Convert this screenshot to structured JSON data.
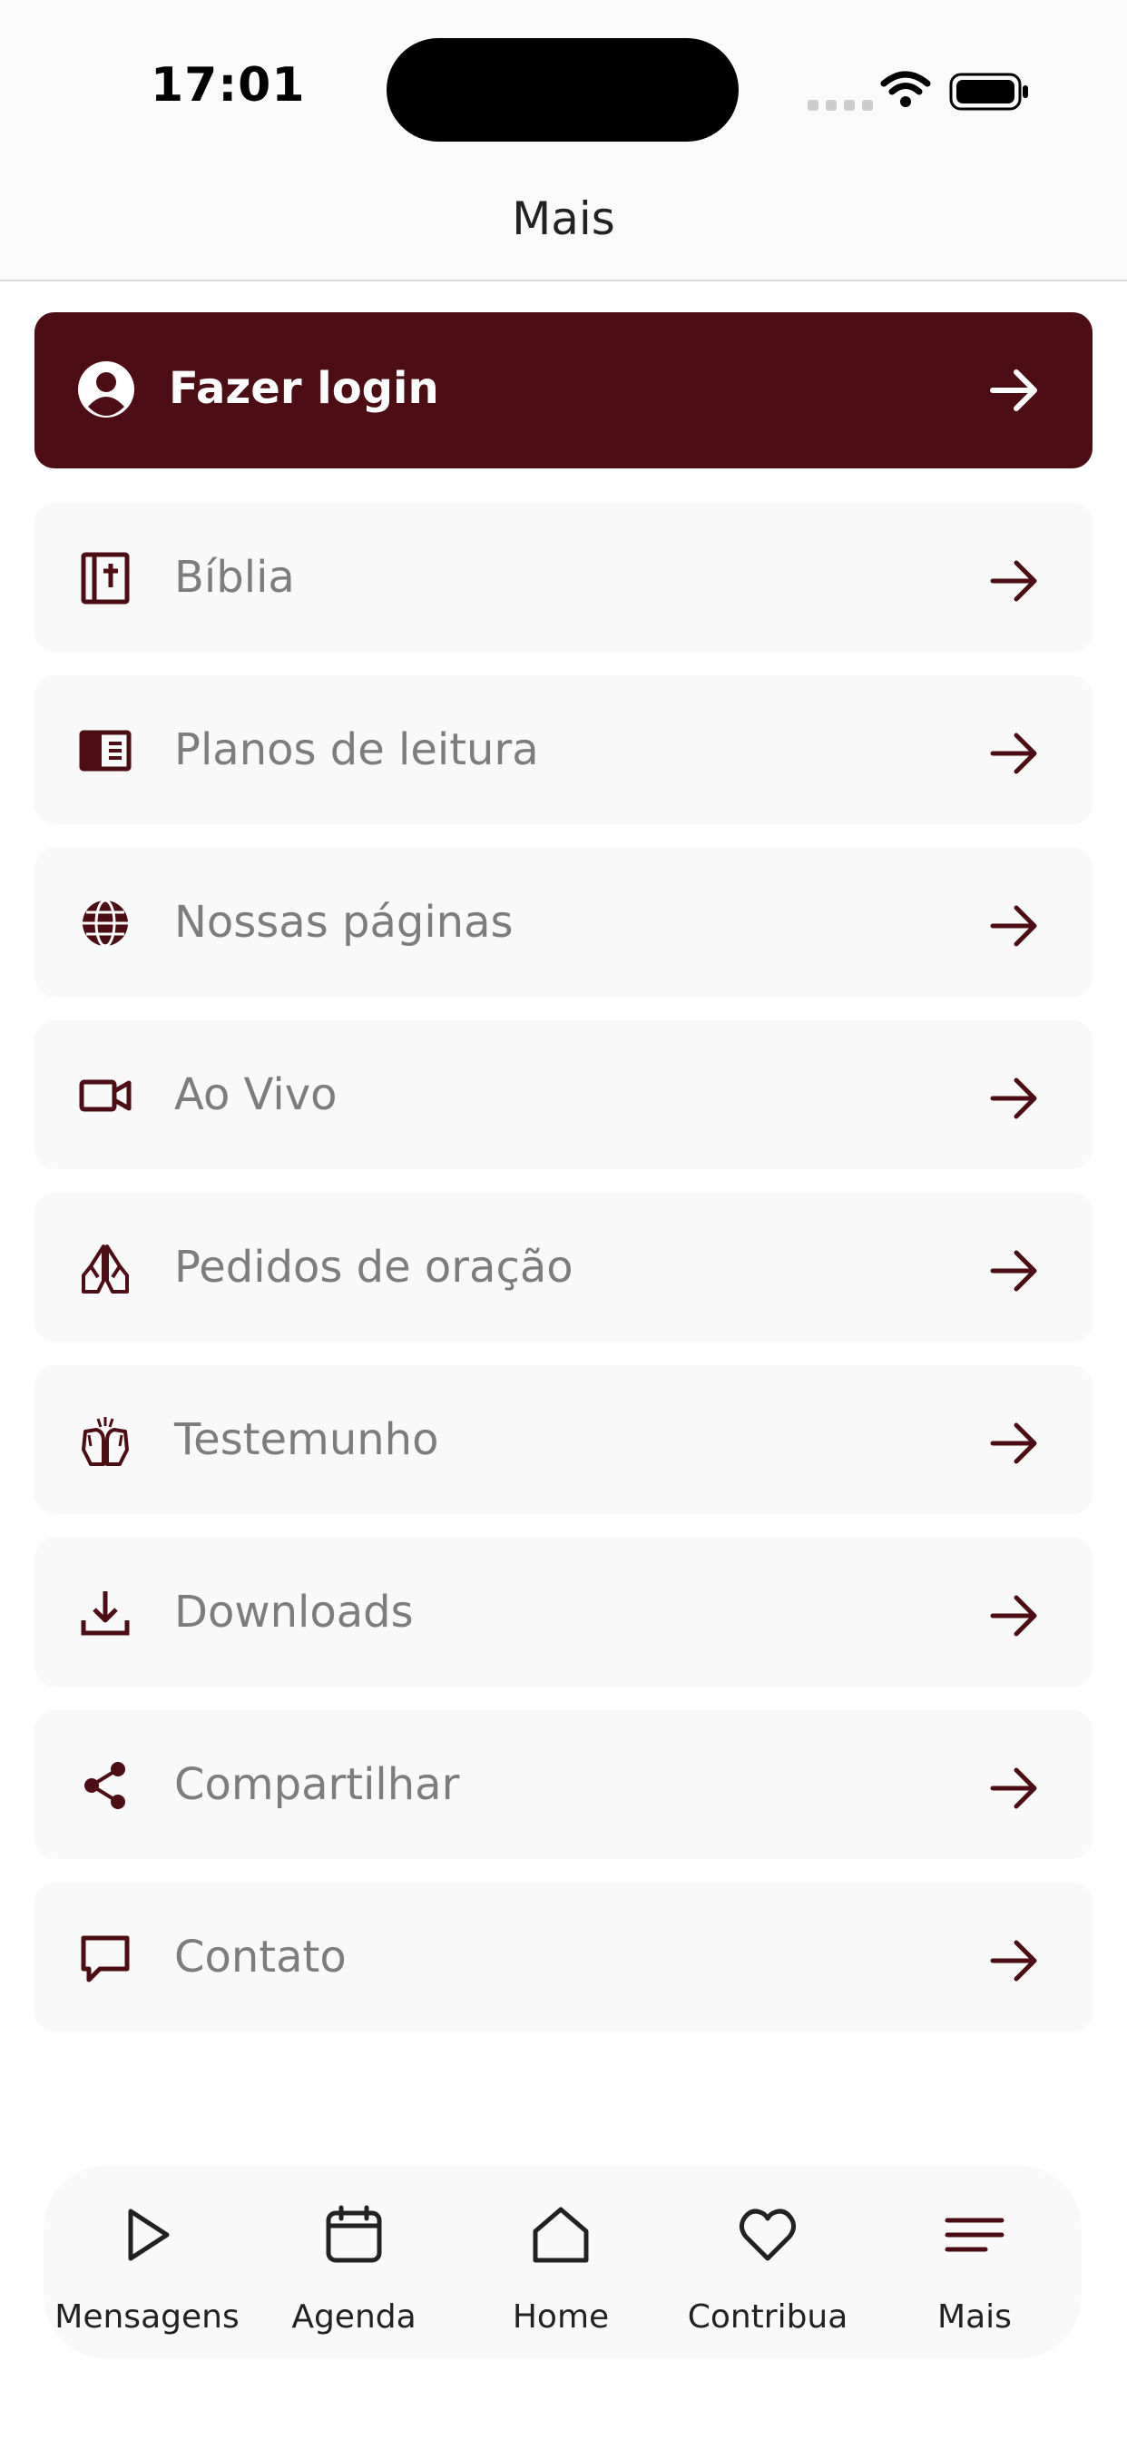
{
  "status_bar": {
    "time": "17:01"
  },
  "header": {
    "title": "Mais"
  },
  "login": {
    "label": "Fazer login",
    "icon": "account-circle-icon"
  },
  "menu": [
    {
      "label": "Bíblia",
      "icon": "bible-icon"
    },
    {
      "label": "Planos de leitura",
      "icon": "book-open-icon"
    },
    {
      "label": "Nossas páginas",
      "icon": "globe-icon"
    },
    {
      "label": "Ao Vivo",
      "icon": "video-camera-icon"
    },
    {
      "label": "Pedidos de oração",
      "icon": "praying-hands-icon"
    },
    {
      "label": "Testemunho",
      "icon": "raised-hands-icon"
    },
    {
      "label": "Downloads",
      "icon": "download-icon"
    },
    {
      "label": "Compartilhar",
      "icon": "share-icon"
    },
    {
      "label": "Contato",
      "icon": "chat-icon"
    }
  ],
  "tabs": [
    {
      "label": "Mensagens",
      "icon": "play-icon"
    },
    {
      "label": "Agenda",
      "icon": "calendar-icon"
    },
    {
      "label": "Home",
      "icon": "home-icon"
    },
    {
      "label": "Contribua",
      "icon": "heart-icon"
    },
    {
      "label": "Mais",
      "icon": "menu-icon"
    }
  ],
  "colors": {
    "brand": "#4c0e14",
    "card": "#f9f9f9",
    "muted_text": "#7d7d7d",
    "active_tab_icon": "#4c0e14"
  }
}
